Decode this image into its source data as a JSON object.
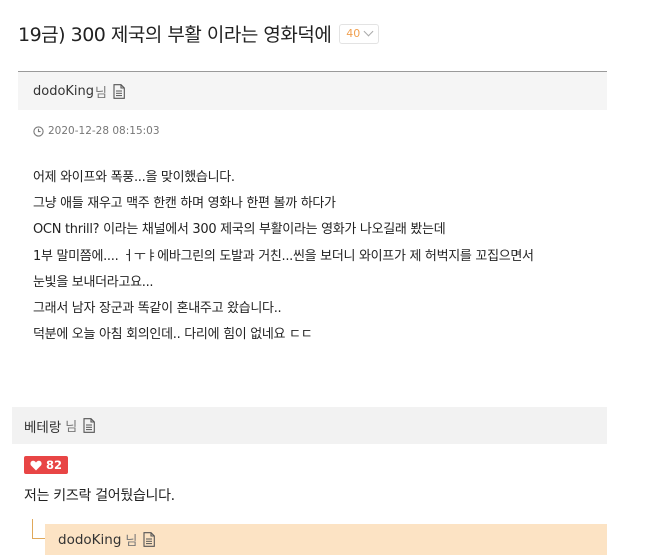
{
  "post": {
    "title": "19금) 300 제국의 부활 이라는 영화덕에",
    "comment_count": "40",
    "author": "dodoKing",
    "honorific": "님",
    "timestamp": "2020-12-28 08:15:03",
    "body_lines": [
      "어제 와이프와 폭풍...을 맞이했습니다.",
      "그냥 애들 재우고 맥주 한캔 하며 영화나 한편 볼까 하다가",
      "OCN thrill? 이라는 채널에서 300 제국의 부활이라는 영화가 나오길래 봤는데",
      "1부 말미쯤에.... ㅓㅜㅑ에바그린의 도발과 거친...씬을 보더니 와이프가 제 허벅지를 꼬집으면서",
      "눈빛을 보내더라고요...",
      "그래서 남자 장군과 똑같이 혼내주고 왔습니다..",
      "덕분에 오늘 아침 회의인데.. 다리에 힘이 없네요 ㄷㄷ"
    ]
  },
  "comments": [
    {
      "author": "베테랑",
      "honorific": "님",
      "likes": "82",
      "text": "저는 키즈락 걸어뒀습니다."
    }
  ],
  "reply": {
    "author": "dodoKing",
    "honorific": "님"
  },
  "colors": {
    "accent_orange": "#f0a050",
    "like_red": "#e84545",
    "reply_bg": "#fce3c4",
    "header_bg": "#f5f5f5"
  },
  "icons": {
    "doc": "document-icon",
    "clock": "clock-icon",
    "heart": "heart-icon",
    "chevron": "chevron-down-icon"
  }
}
